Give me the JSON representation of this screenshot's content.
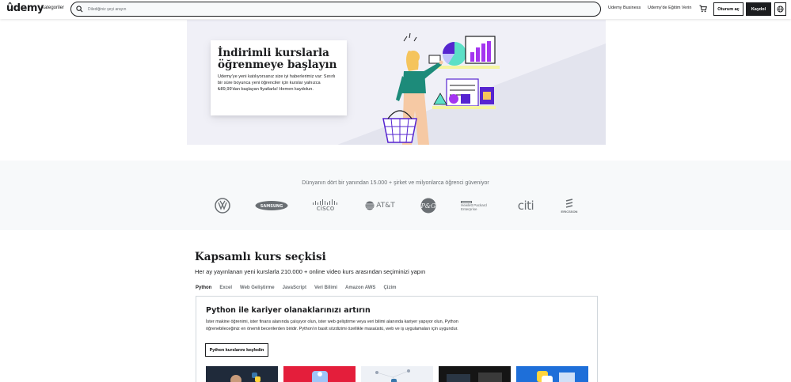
{
  "header": {
    "logo": "ûdemy",
    "categories": "Kategoriler",
    "search_placeholder": "Dilediğiniz şeyi arayın",
    "business": "Udemy Business",
    "teach": "Udemy'de Eğitim Verin",
    "login": "Oturum aç",
    "signup": "Kaydol",
    "accent": "#a435f0"
  },
  "hero": {
    "title": "İndirimli kurslarla öğrenmeye başlayın",
    "text": "Udemy'ye yeni katılıyorsanız size iyi haberlerimiz var: Sınırlı bir süre boyunca yeni öğrenciler için kurslar yalnızca ₺89,99'dan başlayan fiyatlarla! Hemen kaydolun."
  },
  "trusted": {
    "text": "Dünyanın dört bir yanından 15.000 + şirket ve milyonlarca öğrenci güveniyor",
    "logos": [
      "volkswagen-logo",
      "samsung-logo",
      "cisco-logo",
      "att-logo",
      "pg-logo",
      "hewlett-packard-enterprise-logo",
      "citi-logo",
      "ericsson-logo"
    ],
    "samsung": "SAMSUNG",
    "cisco": "cisco",
    "att": "AT&T",
    "pg": "P&G",
    "hpe_line1": "Hewlett Packard",
    "hpe_line2": "Enterprise",
    "citi": "citi",
    "ericsson": "ERICSSON"
  },
  "courses": {
    "title": "Kapsamlı kurs seçkisi",
    "subtitle": "Her ay yayınlanan yeni kurslarla 210.000 + online video kurs arasından seçiminizi yapın",
    "tabs": [
      {
        "label": "Python"
      },
      {
        "label": "Excel"
      },
      {
        "label": "Web Geliştirme"
      },
      {
        "label": "JavaScript"
      },
      {
        "label": "Veri Bilimi"
      },
      {
        "label": "Amazon AWS"
      },
      {
        "label": "Çizim"
      }
    ],
    "panel": {
      "title": "Python ile kariyer olanaklarınızı artırın",
      "text": "İster makine öğrenimi, ister finans alanında çalışıyor olun, ister web geliştirme veya veri bilimi alanında kariyer yapıyor olun, Python öğrenebileceğiniz en önemli becerilerden biridir. Python'ın basit sözdizimi özellikle masaüstü, web ve iş uygulamaları için uygundur.",
      "button": "Python kurslarını keşfedin"
    }
  }
}
